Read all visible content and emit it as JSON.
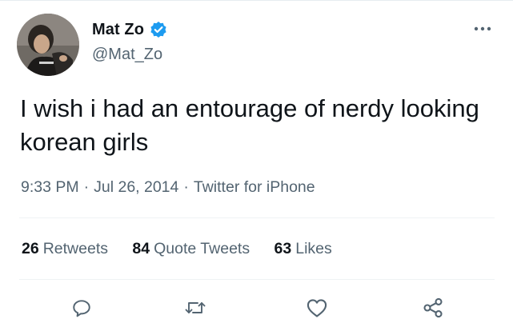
{
  "author": {
    "name": "Mat Zo",
    "handle": "@Mat_Zo",
    "verified": true,
    "verified_color": "#1d9bf0"
  },
  "tweet": {
    "text": "I wish i had an entourage of nerdy looking korean girls",
    "time": "9:33 PM",
    "date": "Jul 26, 2014",
    "source": "Twitter for iPhone",
    "separator": "·"
  },
  "stats": [
    {
      "count": "26",
      "label": "Retweets"
    },
    {
      "count": "84",
      "label": "Quote Tweets"
    },
    {
      "count": "63",
      "label": "Likes"
    }
  ],
  "actions": [
    "reply-icon",
    "retweet-icon",
    "like-icon",
    "share-icon"
  ],
  "colors": {
    "text": "#0f1419",
    "secondary": "#536471",
    "divider": "#eff3f4"
  }
}
